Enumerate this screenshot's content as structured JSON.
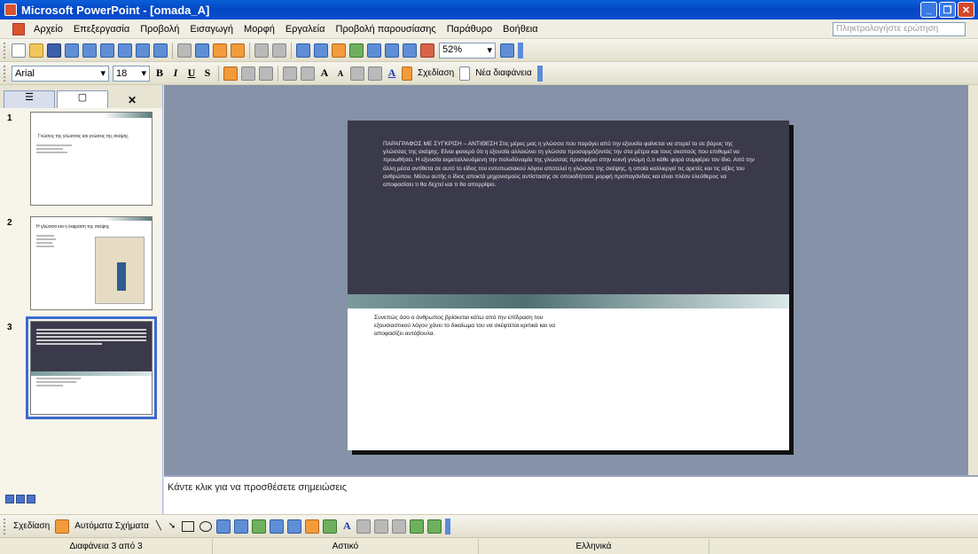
{
  "window": {
    "title": "Microsoft PowerPoint - [omada_A]"
  },
  "menu": {
    "items": [
      "Αρχείο",
      "Επεξεργασία",
      "Προβολή",
      "Εισαγωγή",
      "Μορφή",
      "Εργαλεία",
      "Προβολή παρουσίασης",
      "Παράθυρο",
      "Βοήθεια"
    ],
    "help_placeholder": "Πληκτρολογήστε ερώτηση"
  },
  "standard_toolbar": {
    "zoom": "52%"
  },
  "format_toolbar": {
    "font": "Arial",
    "size": "18",
    "bold": "B",
    "italic": "I",
    "underline": "U",
    "shadow": "S",
    "grow": "A",
    "shrink": "A",
    "design_label": "Σχεδίαση",
    "new_slide_label": "Νέα διαφάνεια"
  },
  "slides_pane": {
    "thumbnails": [
      {
        "number": "1",
        "title": "Γνώσεις της γλώσσας και γνώσεις της σκέψης"
      },
      {
        "number": "2",
        "title": "Η γλώσσα και η έκφραση της σκέψης"
      },
      {
        "number": "3",
        "title": ""
      }
    ]
  },
  "slide": {
    "body_top": "ΠΑΡΑΓΡΑΦΟΣ ΜΕ ΣΥΓΚΡΙΣΗ – ΑΝΤΙΘΕΣΗ Στις μέρες μας η γλώσσα που παράγει από την εξουσία φαίνεται να στερεί το σε βάρος της γλώσσας της σκέψης. Είναι φανερό ότι η εξουσία αλλοιώνει τη γλώσσα προσαρμόζοντάς την στα μέτρα και τους σκοπούς που επιθυμεί να προωθήσει. Η εξουσία εκμεταλλευόμενη την πολυδύναμία της γλώσσας προσφέρει στην κοινή γνώμη ό,τι κάθε φορά συμφέρει τον ίδιο. Από την άλλη μέσα αντίθετα σε αυτό το είδος του εντυπωσιακού λόγου αποτελεί η γλώσσα της σκέψης, η οποία καλλιεργεί τις αρετές και τις αξίες του ανθρώπου. Μέσω αυτής ο ίδιος αποκτά μηχανισμούς αντίστασης σε οποιαδήποτε μορφή προπαγάνδας και είναι πλέον ελεύθερος να αποφασίσει τι θα δεχτεί και τι θα απορρίψει.",
    "body_bottom": "Συνεπώς όσο ο άνθρωπος βρίσκεται κάτω από την επίδραση του εξουσιαστικού λόγου χάνει το δικαίωμα του να σκέφτεται κριτικά και να αποφασίζει αυτόβουλα."
  },
  "notes": {
    "placeholder": "Κάντε κλικ για να προσθέσετε σημειώσεις"
  },
  "drawing_toolbar": {
    "draw_label": "Σχεδίαση",
    "autoshapes_label": "Αυτόματα Σχήματα"
  },
  "status": {
    "slide_count": "Διαφάνεια 3 από 3",
    "design": "Αστικό",
    "language": "Ελληνικά"
  }
}
